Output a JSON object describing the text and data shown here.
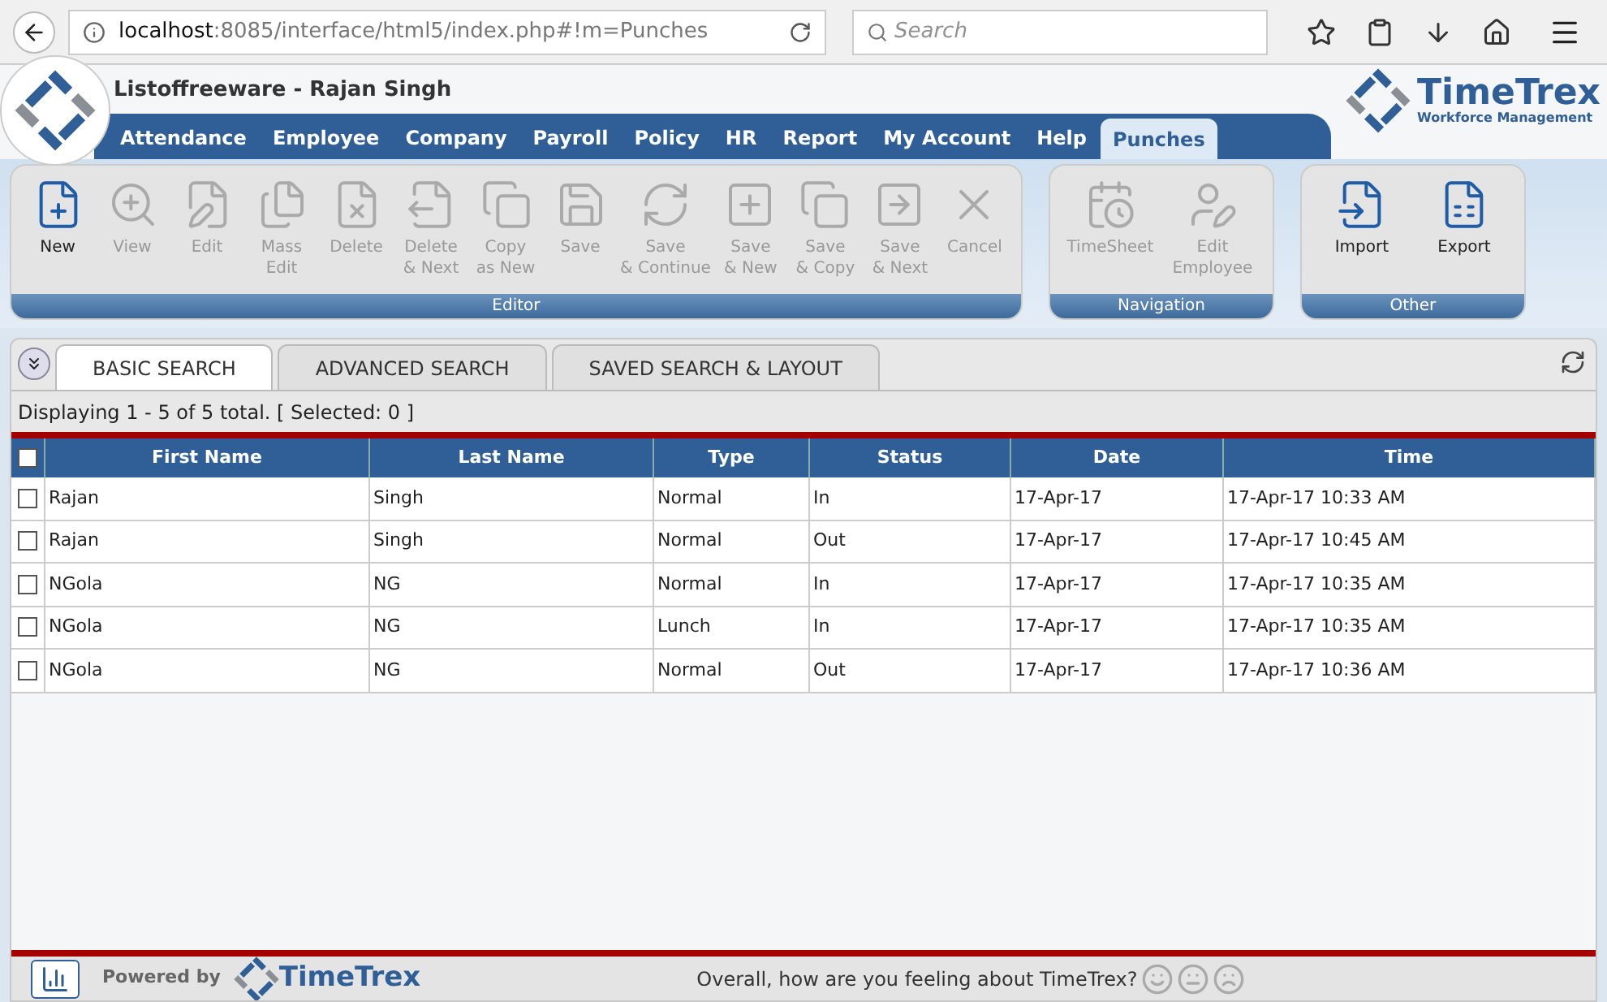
{
  "browser": {
    "url_host": "localhost",
    "url_rest": ":8085/interface/html5/index.php#!m=Punches",
    "search_placeholder": "Search"
  },
  "header": {
    "title": "Listoffreeware - Rajan Singh",
    "brand": "TimeTrex",
    "brand_tagline": "Workforce Management"
  },
  "nav": [
    {
      "label": "Attendance",
      "selected": false
    },
    {
      "label": "Employee",
      "selected": false
    },
    {
      "label": "Company",
      "selected": false
    },
    {
      "label": "Payroll",
      "selected": false
    },
    {
      "label": "Policy",
      "selected": false
    },
    {
      "label": "HR",
      "selected": false
    },
    {
      "label": "Report",
      "selected": false
    },
    {
      "label": "My Account",
      "selected": false
    },
    {
      "label": "Help",
      "selected": false
    },
    {
      "label": "Punches",
      "selected": true
    }
  ],
  "toolbar_groups": [
    {
      "title": "Editor",
      "buttons": [
        {
          "lines": [
            "New"
          ],
          "disabled": false
        },
        {
          "lines": [
            "View"
          ],
          "disabled": true
        },
        {
          "lines": [
            "Edit"
          ],
          "disabled": true
        },
        {
          "lines": [
            "Mass",
            "Edit"
          ],
          "disabled": true
        },
        {
          "lines": [
            "Delete"
          ],
          "disabled": true
        },
        {
          "lines": [
            "Delete",
            "& Next"
          ],
          "disabled": true
        },
        {
          "lines": [
            "Copy",
            "as New"
          ],
          "disabled": true
        },
        {
          "lines": [
            "Save"
          ],
          "disabled": true
        },
        {
          "lines": [
            "Save",
            "& Continue"
          ],
          "disabled": true
        },
        {
          "lines": [
            "Save",
            "& New"
          ],
          "disabled": true
        },
        {
          "lines": [
            "Save",
            "& Copy"
          ],
          "disabled": true
        },
        {
          "lines": [
            "Save",
            "& Next"
          ],
          "disabled": true
        },
        {
          "lines": [
            "Cancel"
          ],
          "disabled": true
        }
      ]
    },
    {
      "title": "Navigation",
      "buttons": [
        {
          "lines": [
            "TimeSheet"
          ],
          "disabled": true
        },
        {
          "lines": [
            "Edit",
            "Employee"
          ],
          "disabled": true
        }
      ]
    },
    {
      "title": "Other",
      "buttons": [
        {
          "lines": [
            "Import"
          ],
          "disabled": false
        },
        {
          "lines": [
            "Export"
          ],
          "disabled": false
        }
      ]
    }
  ],
  "search_tabs": [
    {
      "label": "BASIC SEARCH",
      "selected": true
    },
    {
      "label": "ADVANCED SEARCH",
      "selected": false
    },
    {
      "label": "SAVED SEARCH & LAYOUT",
      "selected": false
    }
  ],
  "status_line": "Displaying 1 - 5 of 5 total. [ Selected: 0 ]",
  "table": {
    "all_selected": false,
    "columns": [
      "First Name",
      "Last Name",
      "Type",
      "Status",
      "Date",
      "Time"
    ],
    "rows": [
      {
        "selected": false,
        "cells": [
          "Rajan",
          "Singh",
          "Normal",
          "In",
          "17-Apr-17",
          "17-Apr-17 10:33 AM"
        ]
      },
      {
        "selected": false,
        "cells": [
          "Rajan",
          "Singh",
          "Normal",
          "Out",
          "17-Apr-17",
          "17-Apr-17 10:45 AM"
        ]
      },
      {
        "selected": false,
        "cells": [
          "NGola",
          "NG",
          "Normal",
          "In",
          "17-Apr-17",
          "17-Apr-17 10:35 AM"
        ]
      },
      {
        "selected": false,
        "cells": [
          "NGola",
          "NG",
          "Lunch",
          "In",
          "17-Apr-17",
          "17-Apr-17 10:35 AM"
        ]
      },
      {
        "selected": false,
        "cells": [
          "NGola",
          "NG",
          "Normal",
          "Out",
          "17-Apr-17",
          "17-Apr-17 10:36 AM"
        ]
      }
    ]
  },
  "footer": {
    "powered_by": "Powered by",
    "brand": "TimeTrex",
    "feedback": "Overall, how are you feeling about TimeTrex?"
  }
}
